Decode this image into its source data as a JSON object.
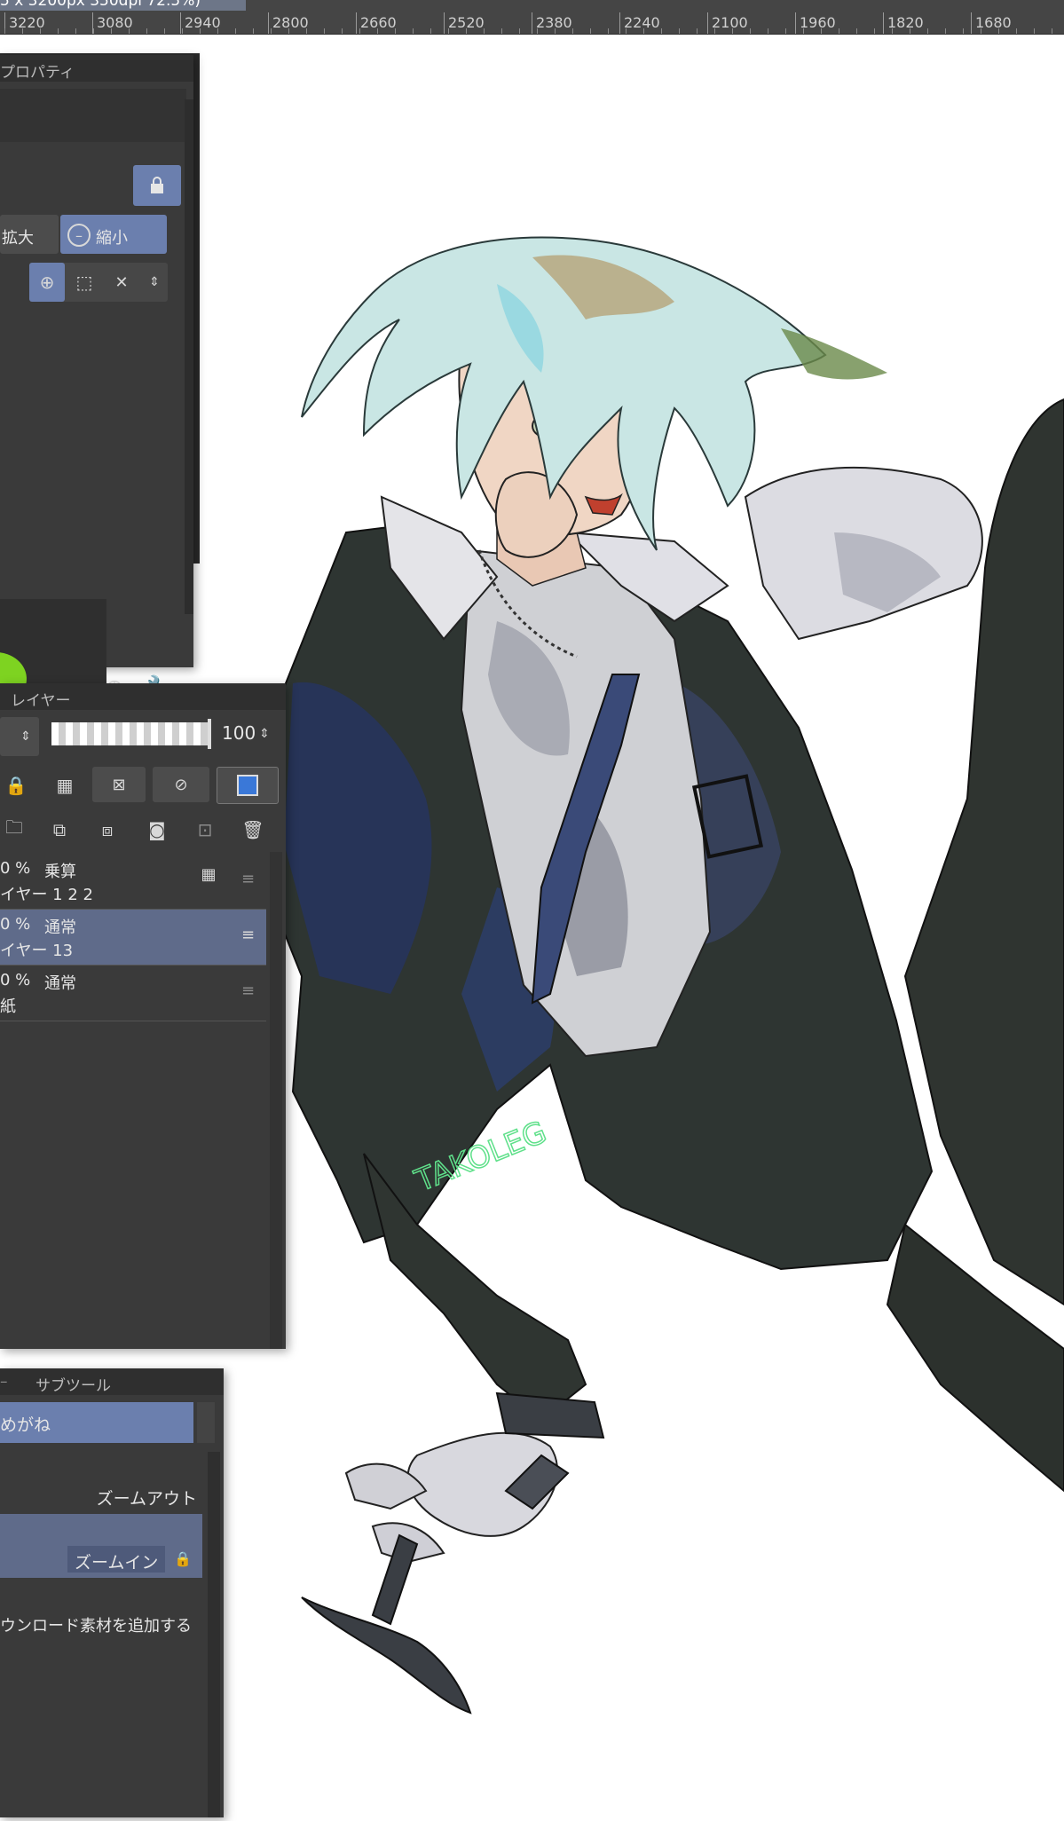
{
  "document_tab": {
    "text": "5 x 3200px 350dpi 72.5%)"
  },
  "ruler": {
    "ticks": [
      "3220",
      "3080",
      "2940",
      "2800",
      "2660",
      "2520",
      "2380",
      "2240",
      "2100",
      "1960",
      "1820",
      "1680"
    ]
  },
  "property_panel": {
    "title": "プロパティ",
    "zoom_in_label": "拡大",
    "zoom_out_label": "縮小",
    "lock_icon": "lock-icon",
    "tool_icons": [
      "zoom-click-icon",
      "zoom-area-icon",
      "zoom-reset-icon"
    ]
  },
  "layer_panel": {
    "title": "レイヤー",
    "opacity": "100",
    "layers": [
      {
        "percent": "0 %",
        "mode": "乗算",
        "name": "イヤー 1 2 2",
        "selected": false
      },
      {
        "percent": "0 %",
        "mode": "通常",
        "name": "イヤー 13",
        "selected": true
      },
      {
        "percent": "0 %",
        "mode": "通常",
        "name": "紙",
        "selected": false
      }
    ]
  },
  "subtool_panel": {
    "title": "サブツール",
    "group_name": "めがね",
    "items": [
      "ズームアウト",
      "ズームイン"
    ],
    "add_material_label": "ウンロード素材を追加する"
  },
  "artwork": {
    "signature": "TAKOLEG"
  },
  "colors": {
    "panel_bg": "#3a3a3a",
    "accent": "#6b7fae",
    "green_swatch": "#7ed321"
  }
}
